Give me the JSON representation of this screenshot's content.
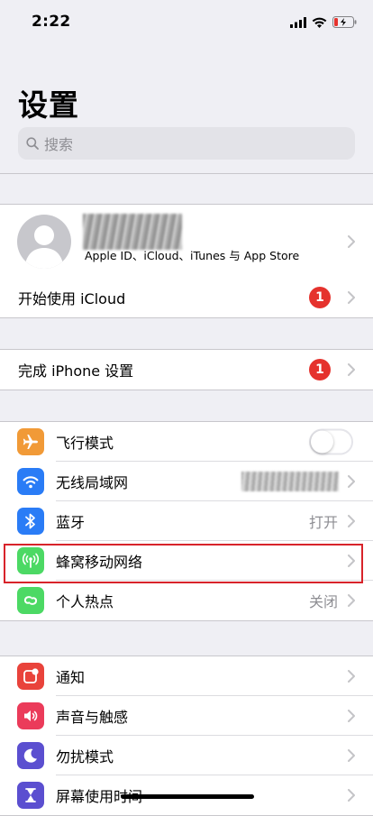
{
  "status_bar": {
    "time": "2:22"
  },
  "page_title": "设置",
  "search": {
    "placeholder": "搜索"
  },
  "profile": {
    "subtitle": "Apple ID、iCloud、iTunes 与 App Store",
    "icloud_label": "开始使用 iCloud",
    "icloud_badge": "1"
  },
  "setup": {
    "label": "完成 iPhone 设置",
    "badge": "1"
  },
  "connectivity": {
    "airplane": "飞行模式",
    "wifi": "无线局域网",
    "bluetooth": "蓝牙",
    "bluetooth_value": "打开",
    "cellular": "蜂窝移动网络",
    "hotspot": "个人热点",
    "hotspot_value": "关闭"
  },
  "notifications": {
    "notifications": "通知",
    "sounds": "声音与触感",
    "dnd": "勿扰模式",
    "screen_time": "屏幕使用时间"
  },
  "colors": {
    "airplane": "#f19a37",
    "wifi": "#2a7cf6",
    "bluetooth": "#2a7cf6",
    "cellular": "#4cd964",
    "hotspot": "#4cd964",
    "notifications": "#e9433b",
    "sounds": "#eb3b5a",
    "dnd": "#5b4fd0",
    "screen_time": "#5b4fd0",
    "highlight": "#d8232a",
    "badge": "#e5322d"
  },
  "icons": {
    "airplane": "airplane-icon",
    "wifi": "wifi-icon",
    "bluetooth": "bluetooth-icon",
    "cellular": "cellular-antenna-icon",
    "hotspot": "hotspot-link-icon",
    "notifications": "notification-badge-icon",
    "sounds": "speaker-icon",
    "dnd": "moon-icon",
    "screen_time": "hourglass-icon"
  }
}
